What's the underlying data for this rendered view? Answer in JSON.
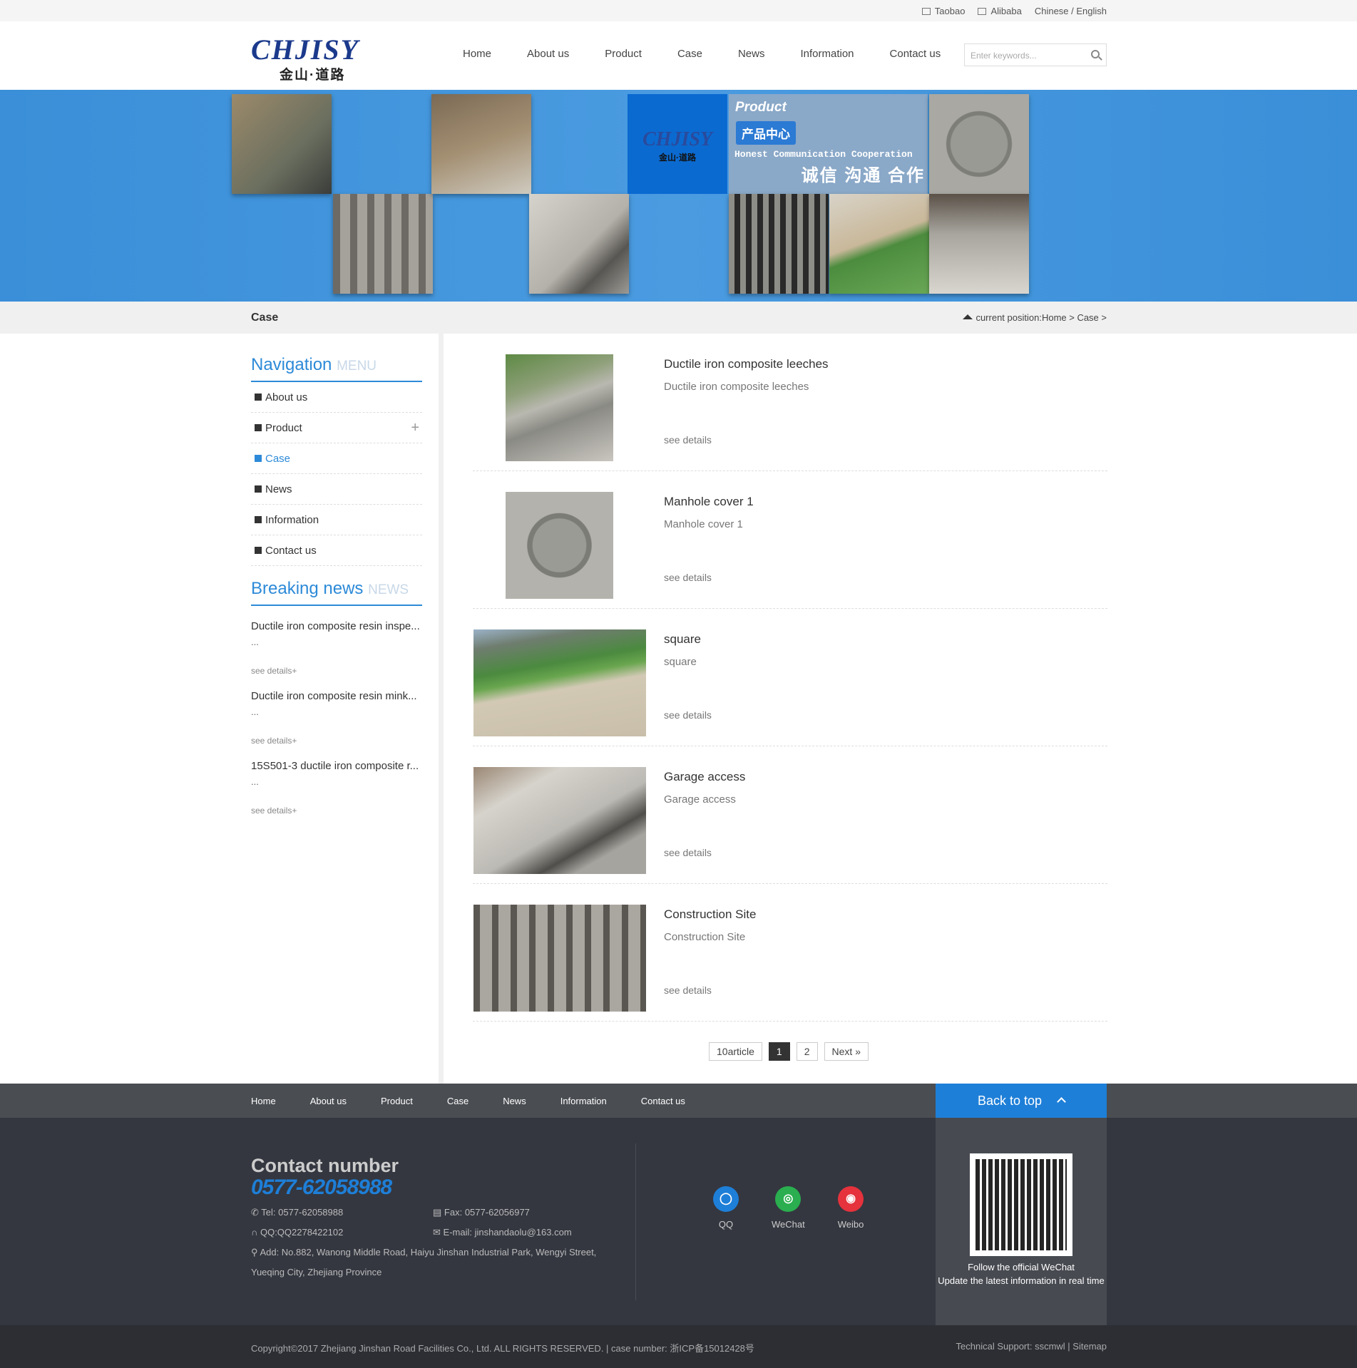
{
  "topbar": {
    "taobao": "Taobao",
    "alibaba": "Alibaba",
    "lang": "Chinese / English"
  },
  "logo": {
    "en": "CHJISY",
    "cn": "金山·道路"
  },
  "nav": {
    "items": [
      "Home",
      "About us",
      "Product",
      "Case",
      "News",
      "Information",
      "Contact us"
    ],
    "active": "Case"
  },
  "search": {
    "placeholder": "Enter keywords..."
  },
  "banner": {
    "tag_en": "Product",
    "tag_cn": "产品中心",
    "motto_en": "Honest Communication Cooperation",
    "motto_cn": "诚信 沟通 合作"
  },
  "crumb": {
    "title": "Case",
    "position": "current position:Home > Case >"
  },
  "sidebar": {
    "nav_title": "Navigation",
    "nav_sub": "MENU",
    "items": [
      "About us",
      "Product",
      "Case",
      "News",
      "Information",
      "Contact us"
    ],
    "news_title": "Breaking news",
    "news_sub": "NEWS",
    "news": [
      {
        "t": "Ductile iron composite resin inspe...",
        "d": "...",
        "m": "see details+"
      },
      {
        "t": "Ductile iron composite resin mink...",
        "d": "...",
        "m": "see details+"
      },
      {
        "t": "15S501-3 ductile iron composite r...",
        "d": "...",
        "m": "see details+"
      }
    ]
  },
  "cases": [
    {
      "title": "Ductile iron composite leeches",
      "sub": "Ductile iron composite leeches",
      "more": "see details"
    },
    {
      "title": "Manhole cover 1",
      "sub": "Manhole cover 1",
      "more": "see details"
    },
    {
      "title": "square",
      "sub": "square",
      "more": "see details"
    },
    {
      "title": "Garage access",
      "sub": "Garage access",
      "more": "see details"
    },
    {
      "title": "Construction Site",
      "sub": "Construction Site",
      "more": "see details"
    }
  ],
  "pager": {
    "count": "10article",
    "p1": "1",
    "p2": "2",
    "next": "Next »"
  },
  "footer": {
    "links": [
      "Home",
      "About us",
      "Product",
      "Case",
      "News",
      "Information",
      "Contact us"
    ],
    "backtop": "Back to top",
    "contact_h": "Contact number",
    "phone": "0577-62058988",
    "tel": "Tel:  0577-62058988",
    "fax": "Fax:  0577-62056977",
    "qq": "QQ:QQ2278422102",
    "email": "E-mail:  jinshandaolu@163.com",
    "addr1": "Add:  No.882, Wanong Middle Road, Haiyu Jinshan Industrial Park, Wengyi Street,",
    "addr2": "Yueqing City, Zhejiang Province",
    "social": [
      "QQ",
      "WeChat",
      "Weibo"
    ],
    "wx1": "Follow the official WeChat",
    "wx2": "Update the latest information in real time",
    "copy": "Copyright©2017 Zhejiang Jinshan Road Facilities Co., Ltd. ALL RIGHTS RESERVED.  |  case number: 浙ICP备15012428号",
    "support": "Technical Support:  sscmwl  |  Sitemap"
  },
  "colors": {
    "accent": "#1e7fd8",
    "banner": "#3a8fd8",
    "footer": "#343740"
  }
}
